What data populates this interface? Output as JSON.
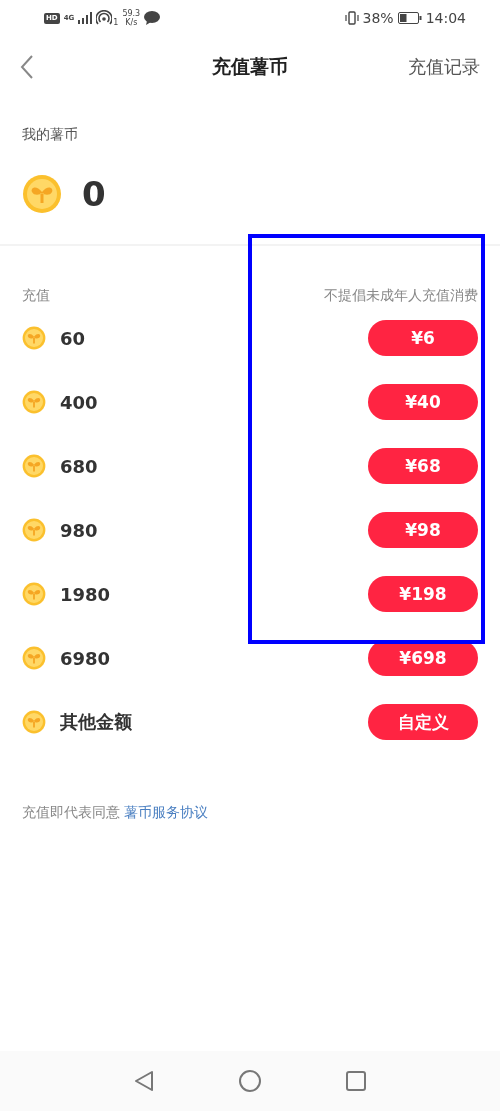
{
  "status_bar": {
    "hd": "HD",
    "network": "4G",
    "hotspot_count": "1",
    "speed": "59.3",
    "speed_unit": "K/s",
    "battery": "38%",
    "time": "14:04"
  },
  "header": {
    "title": "充值薯币",
    "action": "充值记录"
  },
  "balance": {
    "label": "我的薯币",
    "amount": "0"
  },
  "recharge": {
    "label": "充值",
    "notice": "不提倡未成年人充值消费",
    "options": [
      {
        "amount": "60",
        "price": "¥6"
      },
      {
        "amount": "400",
        "price": "¥40"
      },
      {
        "amount": "680",
        "price": "¥68"
      },
      {
        "amount": "980",
        "price": "¥98"
      },
      {
        "amount": "1980",
        "price": "¥198"
      },
      {
        "amount": "6980",
        "price": "¥698"
      },
      {
        "amount": "其他金额",
        "price": "自定义"
      }
    ]
  },
  "agreement": {
    "text": "充值即代表同意",
    "link": "薯币服务协议"
  },
  "annotation": {
    "kind": "rectangle"
  }
}
